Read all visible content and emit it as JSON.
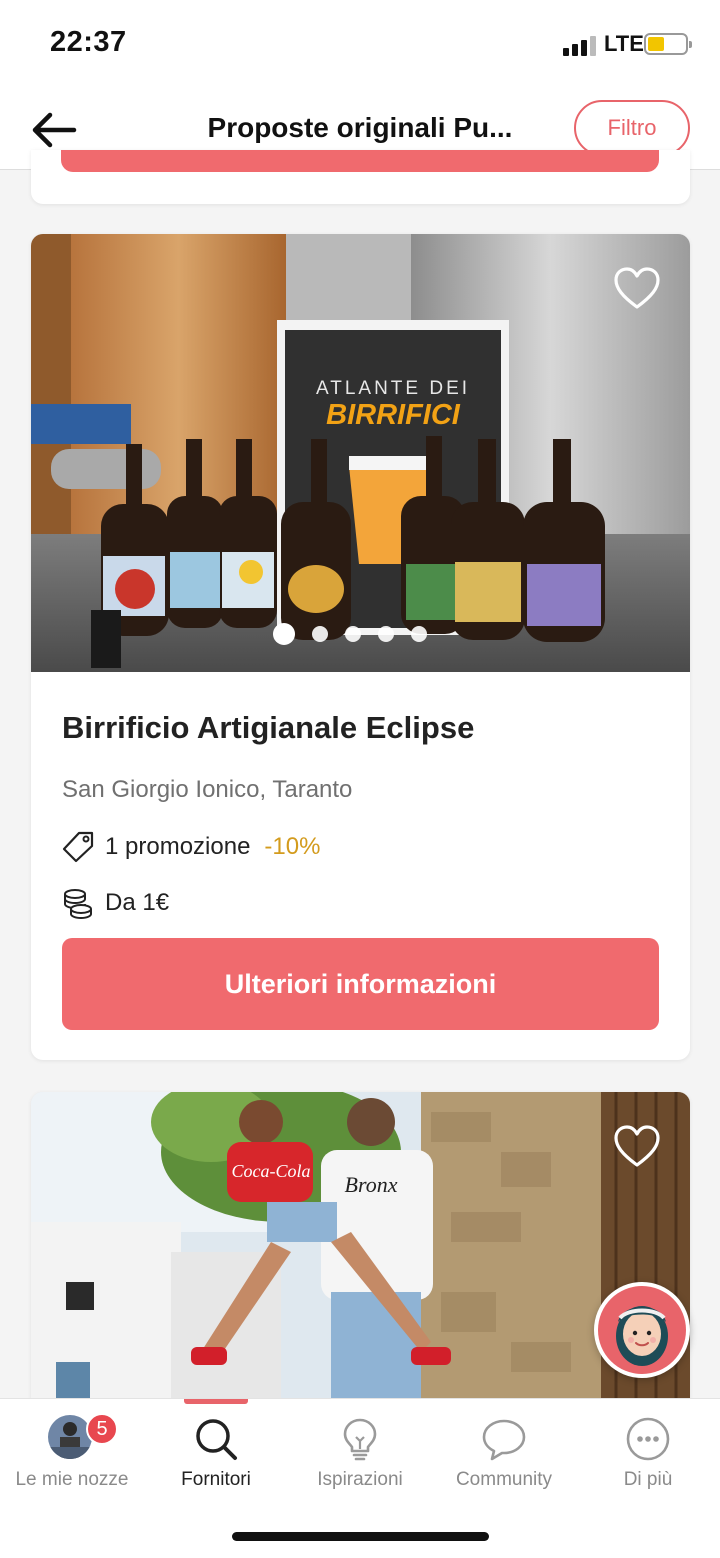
{
  "status_bar": {
    "time": "22:37",
    "network": "LTE",
    "battery_level": 0.35,
    "signal_bars": 3
  },
  "header": {
    "back_icon": "arrow-left-icon",
    "title": "Proposte originali Pu...",
    "filter_label": "Filtro"
  },
  "vendor_card": {
    "name": "Birrificio Artigianale Eclipse",
    "location": "San Giorgio Ionico, Taranto",
    "promotion_text": "1 promozione",
    "promotion_discount": "-10%",
    "price": "Da 1€",
    "cta_label": "Ulteriori informazioni",
    "photo_count": 5,
    "active_photo_index": 0,
    "book_lines": [
      "ATLANTE DEI",
      "BIRRIFICI"
    ],
    "favorite_icon": "heart-outline-icon",
    "promo_icon": "tag-icon",
    "price_icon": "coins-icon"
  },
  "next_card": {
    "favorite_icon": "heart-outline-icon",
    "shirt_text": "Bronx"
  },
  "assistant": {
    "icon": "assistant-avatar-icon"
  },
  "bottom_nav": {
    "items": [
      {
        "label": "Le mie nozze",
        "icon": "avatar-icon",
        "badge": "5"
      },
      {
        "label": "Fornitori",
        "icon": "search-icon"
      },
      {
        "label": "Ispirazioni",
        "icon": "lightbulb-icon"
      },
      {
        "label": "Community",
        "icon": "chat-bubble-icon"
      },
      {
        "label": "Di più",
        "icon": "more-icon"
      }
    ],
    "active_index": 1
  },
  "colors": {
    "accent": "#f06a6e",
    "discount": "#d39b1d",
    "badge": "#e8474f"
  }
}
